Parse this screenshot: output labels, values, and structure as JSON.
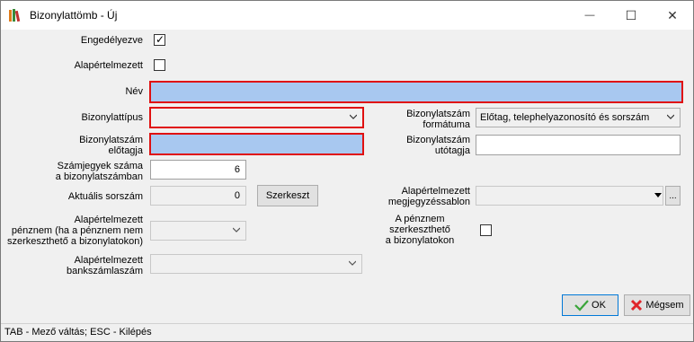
{
  "window": {
    "title": "Bizonylattömb - Új",
    "minimize": "—",
    "maximize": "☐",
    "close": "✕"
  },
  "form": {
    "enabled_label": "Engedélyezve",
    "enabled_checked": true,
    "default_label": "Alapértelmezett",
    "default_checked": false,
    "name_label": "Név",
    "name_value": "",
    "doc_type_label": "Bizonylattípus",
    "doc_type_value": "",
    "doc_prefix_label_1": "Bizonylatszám",
    "doc_prefix_label_2": "előtagja",
    "doc_prefix_value": "",
    "digits_label_1": "Számjegyek száma",
    "digits_label_2": "a bizonylatszámban",
    "digits_value": "6",
    "current_serial_label": "Aktuális sorszám",
    "current_serial_value": "0",
    "edit_button": "Szerkeszt",
    "currency_label_1": "Alapértelmezett",
    "currency_label_2": "pénznem (ha a pénznem nem",
    "currency_label_3": "szerkeszthető a bizonylatokon)",
    "currency_value": "",
    "bank_label_1": "Alapértelmezett",
    "bank_label_2": "bankszámlaszám",
    "bank_value": "",
    "number_format_label_1": "Bizonylatszám",
    "number_format_label_2": "formátuma",
    "number_format_value": "Előtag, telephelyazonosító és sorszám",
    "suffix_label_1": "Bizonylatszám",
    "suffix_label_2": "utótagja",
    "suffix_value": "",
    "note_template_label_1": "Alapértelmezett",
    "note_template_label_2": "megjegyzéssablon",
    "note_template_value": "",
    "note_template_more": "...",
    "currency_editable_label_1": "A pénznem",
    "currency_editable_label_2": "szerkeszthető",
    "currency_editable_label_3": "a bizonylatokon",
    "currency_editable_checked": false
  },
  "buttons": {
    "ok": "OK",
    "cancel": "Mégsem"
  },
  "status_bar": {
    "text": "TAB - Mező váltás; ESC - Kilépés"
  },
  "colors": {
    "required_fill": "#a8c8f0",
    "required_border": "#e01010",
    "ok_check": "#3aa53a",
    "cancel_x": "#e0242a"
  }
}
